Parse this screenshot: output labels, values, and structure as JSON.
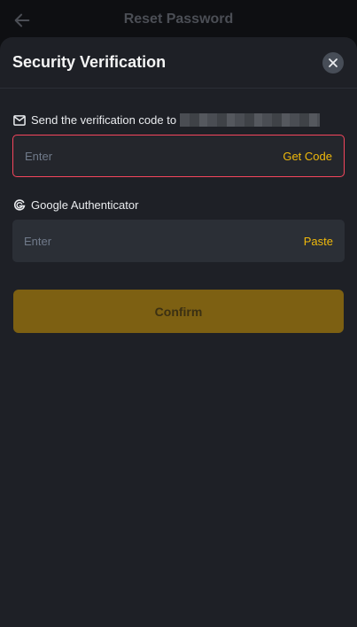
{
  "background_page": {
    "title": "Reset Password",
    "back_icon": "arrow-left-icon"
  },
  "sheet": {
    "title": "Security Verification",
    "close_icon": "close-icon"
  },
  "email_verification": {
    "label": "Send the verification code to",
    "label_icon": "mail-icon",
    "input_placeholder": "Enter",
    "action_label": "Get Code",
    "state": "error"
  },
  "google_authenticator": {
    "label": "Google Authenticator",
    "label_icon": "google-icon",
    "input_placeholder": "Enter",
    "action_label": "Paste"
  },
  "confirm": {
    "label": "Confirm",
    "enabled": false
  },
  "colors": {
    "accent": "#f0b90b",
    "error": "#f6465d",
    "sheet_bg": "#1e2026",
    "input_bg": "#2b2f36"
  }
}
